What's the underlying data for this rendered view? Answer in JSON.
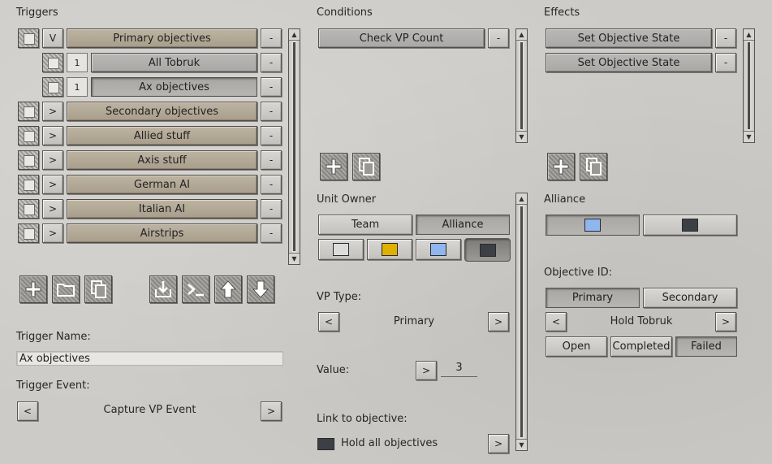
{
  "headers": {
    "triggers": "Triggers",
    "conditions": "Conditions",
    "effects": "Effects"
  },
  "triggers": {
    "items": [
      {
        "toggle": "V",
        "label": "Primary objectives"
      },
      {
        "count": "1",
        "label": "All Tobruk"
      },
      {
        "count": "1",
        "label": "Ax objectives"
      },
      {
        "toggle": ">",
        "label": "Secondary objectives"
      },
      {
        "toggle": ">",
        "label": "Allied stuff"
      },
      {
        "toggle": ">",
        "label": "Axis stuff"
      },
      {
        "toggle": ">",
        "label": "German AI"
      },
      {
        "toggle": ">",
        "label": "Italian AI"
      },
      {
        "toggle": ">",
        "label": "Airstrips"
      }
    ],
    "remove_label": "-",
    "name_label": "Trigger Name:",
    "name_value": "Ax objectives",
    "event_label": "Trigger Event:",
    "event_value": "Capture VP Event",
    "prev": "<",
    "next": ">"
  },
  "conditions": {
    "items": [
      {
        "label": "Check VP Count"
      }
    ],
    "remove_label": "-",
    "unit_owner_label": "Unit Owner",
    "owner_tabs": [
      "Team",
      "Alliance"
    ],
    "vp_type_label": "VP Type:",
    "vp_type_value": "Primary",
    "value_label": "Value:",
    "value": "3",
    "link_label": "Link to objective:",
    "link_value": "Hold all objectives",
    "prev": "<",
    "next": ">"
  },
  "effects": {
    "items": [
      {
        "label": "Set Objective State"
      },
      {
        "label": "Set Objective State"
      }
    ],
    "remove_label": "-",
    "alliance_label": "Alliance",
    "objective_id_label": "Objective ID:",
    "objective_tabs": [
      "Primary",
      "Secondary"
    ],
    "objective_value": "Hold Tobruk",
    "state_buttons": [
      "Open",
      "Completed",
      "Failed"
    ],
    "prev": "<",
    "next": ">"
  },
  "colors": {
    "white": "#dcdcdc",
    "yellow": "#e0b000",
    "blue": "#8fb6ee",
    "dark": "#3c4046"
  }
}
